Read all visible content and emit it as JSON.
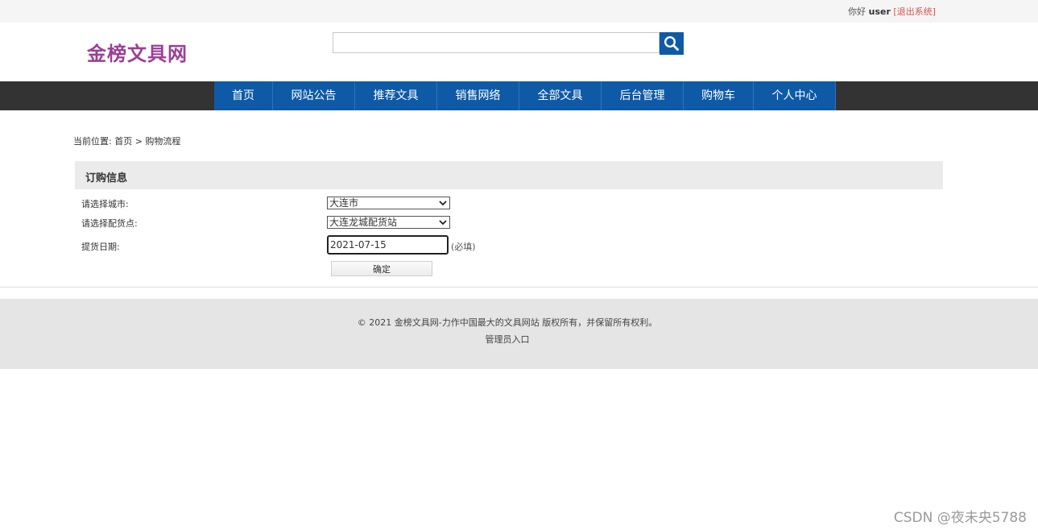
{
  "topbar": {
    "greeting": "你好",
    "username": "user",
    "logout_label": "[退出系统]"
  },
  "header": {
    "logo": "金榜文具网",
    "search_placeholder": "",
    "search_icon": "magnifier-icon"
  },
  "nav": {
    "items": [
      {
        "label": "首页"
      },
      {
        "label": "网站公告"
      },
      {
        "label": "推荐文具"
      },
      {
        "label": "销售网络"
      },
      {
        "label": "全部文具"
      },
      {
        "label": "后台管理"
      },
      {
        "label": "购物车"
      },
      {
        "label": "个人中心"
      }
    ]
  },
  "breadcrumb": {
    "prefix": "当前位置: ",
    "home": "首页",
    "separator": " > ",
    "current": "购物流程"
  },
  "order": {
    "title": "订购信息",
    "city_label": "请选择城市:",
    "city_value": "大连市",
    "store_label": "请选择配货点:",
    "store_value": "大连龙城配货站",
    "date_label": "提货日期:",
    "date_value": "2021-07-15",
    "required_note": "(必填)",
    "confirm_label": "确定"
  },
  "footer": {
    "copyright": "© 2021 金榜文具网-力作中国最大的文具网站 版权所有，并保留所有权利。",
    "admin_link": "管理员入口"
  },
  "watermark": "CSDN @夜未央5788",
  "colors": {
    "nav_blue": "#0e5aa7",
    "nav_bar": "#333333",
    "logo": "#9a3f97",
    "logout": "#d9534f"
  }
}
